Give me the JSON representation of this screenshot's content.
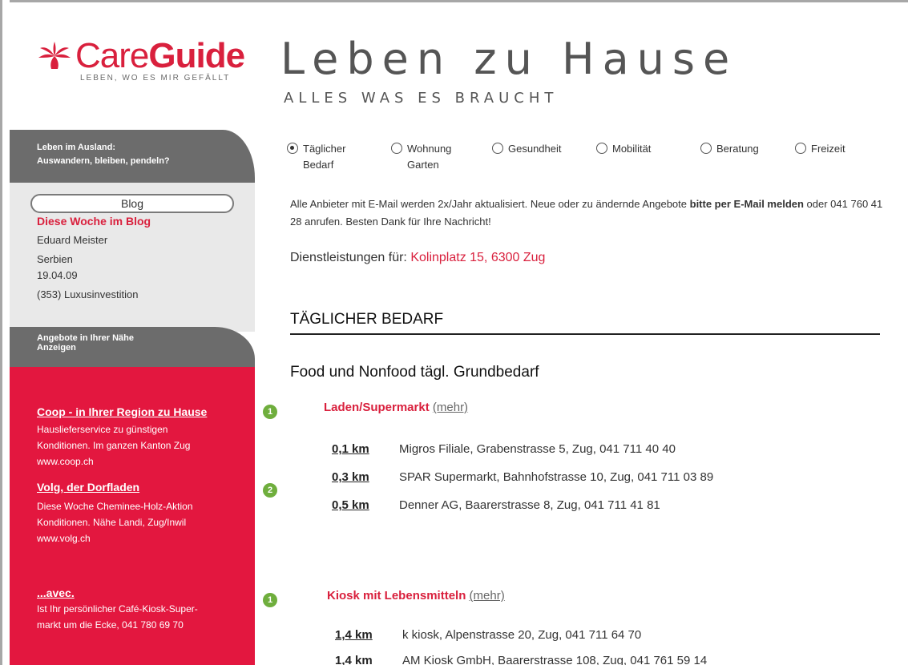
{
  "logo": {
    "care": "Care",
    "guide": "Guide",
    "tagline": "LEBEN, WO ES MIR GEFÄLLT",
    "color": "#d9203d"
  },
  "header": {
    "title": "Leben zu Hause",
    "subtitle": "ALLES WAS ES BRAUCHT"
  },
  "sidebar": {
    "abroad_line1": "Leben im Ausland:",
    "abroad_line2": "Auswandern, bleiben, pendeln?",
    "blog_button": "Blog",
    "blog_week": "Diese Woche im Blog",
    "blog_author": "Eduard Meister",
    "blog_country": "Serbien",
    "blog_date": "19.04.09",
    "blog_post": "(353) Luxusinvestition",
    "offers_line1": "Angebote in Ihrer Nähe",
    "offers_line2": "Anzeigen",
    "ads": [
      {
        "title": "Coop - in Ihrer Region zu Hause",
        "line1": "Hauslieferservice zu günstigen",
        "line2": "Konditionen. Im ganzen Kanton Zug",
        "line3": "www.coop.ch",
        "badge": "1"
      },
      {
        "title": "Volg, der Dorfladen",
        "line1": "Diese Woche Cheminee-Holz-Aktion",
        "line2": "Konditionen. Nähe Landi, Zug/Inwil",
        "line3": "www.volg.ch",
        "badge": "2"
      },
      {
        "title": "...avec.",
        "line1": "Ist Ihr persönlicher Café-Kiosk-Super-",
        "line2": "markt um die Ecke, 041 780 69 70",
        "badge": "1"
      }
    ]
  },
  "filters": [
    {
      "line1": "Täglicher",
      "line2": "Bedarf",
      "checked": true
    },
    {
      "line1": "Wohnung",
      "line2": "Garten",
      "checked": false
    },
    {
      "line1": "Gesundheit",
      "line2": "",
      "checked": false
    },
    {
      "line1": "Mobilität",
      "line2": "",
      "checked": false
    },
    {
      "line1": "Beratung",
      "line2": "",
      "checked": false
    },
    {
      "line1": "Freizeit",
      "line2": "",
      "checked": false
    }
  ],
  "notice": {
    "part1": "Alle Anbieter mit E-Mail werden 2x/Jahr aktualisiert. Neue oder zu ändernde Angebote ",
    "bold1": "bitte per E-Mail melden",
    "part2": " oder 041 760 41 28 anrufen. Besten Dank für Ihre Nachricht!"
  },
  "service": {
    "label": "Dienstleistungen für: ",
    "address": "Kolinplatz 15, 6300 Zug"
  },
  "section_title": "TÄGLICHER BEDARF",
  "subsection_title": "Food und Nonfood tägl. Grundbedarf",
  "categories": [
    {
      "name": "Laden/Supermarkt",
      "more": "(mehr)",
      "entries": [
        {
          "km": "0,1 km",
          "text": "Migros Filiale, Grabenstrasse 5, Zug, 041 711 40 40"
        },
        {
          "km": "0,3 km",
          "text": "SPAR Supermarkt, Bahnhofstrasse 10, Zug, 041 711 03 89"
        },
        {
          "km": "0,5 km",
          "text": "Denner AG, Baarerstrasse 8, Zug, 041 711 41 81"
        }
      ]
    },
    {
      "name": "Kiosk mit Lebensmitteln",
      "more": "(mehr)",
      "entries": [
        {
          "km": "1,4 km",
          "text": "k kiosk, Alpenstrasse 20, Zug, 041 711 64 70"
        },
        {
          "km": "1,4 km",
          "text": "AM Kiosk GmbH, Baarerstrasse 108, Zug, 041 761 59 14"
        }
      ]
    }
  ]
}
